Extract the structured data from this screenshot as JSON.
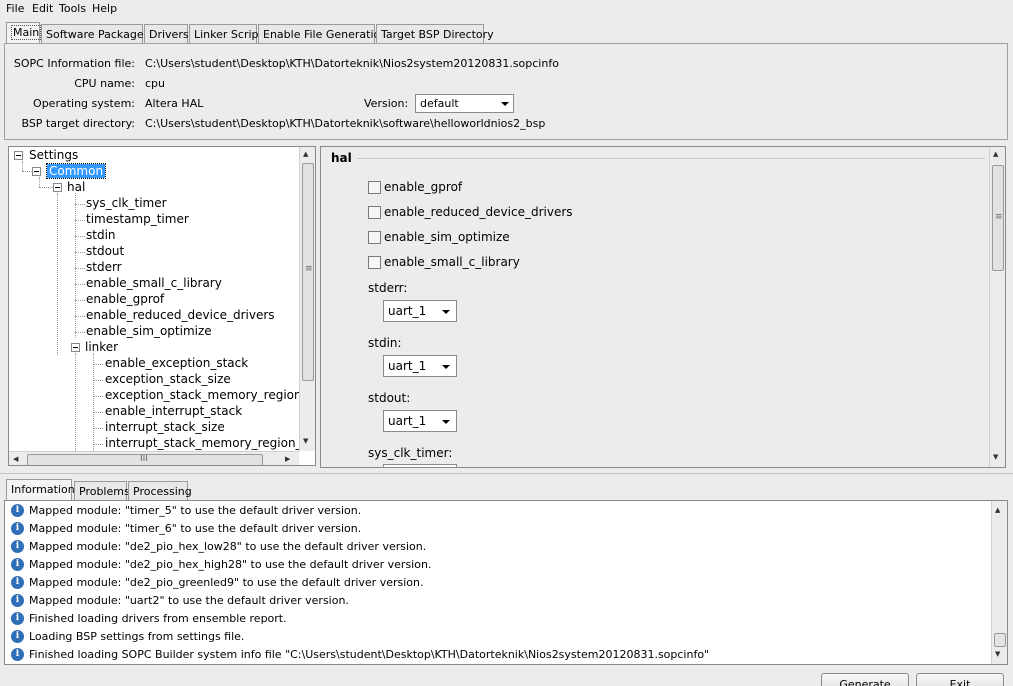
{
  "menu": [
    "File",
    "Edit",
    "Tools",
    "Help"
  ],
  "tabs": [
    "Main",
    "Software Packages",
    "Drivers",
    "Linker Script",
    "Enable File Generation",
    "Target BSP Directory"
  ],
  "main": {
    "sopc_label": "SOPC Information file:",
    "sopc_value": "C:\\Users\\student\\Desktop\\KTH\\Datorteknik\\Nios2system20120831.sopcinfo",
    "cpu_label": "CPU name:",
    "cpu_value": "cpu",
    "os_label": "Operating system:",
    "os_value": "Altera HAL",
    "version_label": "Version:",
    "version_value": "default",
    "bsp_label": "BSP target directory:",
    "bsp_value": "C:\\Users\\student\\Desktop\\KTH\\Datorteknik\\software\\helloworldnios2_bsp"
  },
  "tree": {
    "settings": "Settings",
    "common": "Common",
    "hal": "hal",
    "hal_items": [
      "sys_clk_timer",
      "timestamp_timer",
      "stdin",
      "stdout",
      "stderr",
      "enable_small_c_library",
      "enable_gprof",
      "enable_reduced_device_drivers",
      "enable_sim_optimize"
    ],
    "linker": "linker",
    "linker_items": [
      "enable_exception_stack",
      "exception_stack_size",
      "exception_stack_memory_region_n",
      "enable_interrupt_stack",
      "interrupt_stack_size",
      "interrupt_stack_memory_region_na"
    ],
    "hscroll_grip": "III",
    "vscroll_grip": "≡"
  },
  "hal_panel": {
    "title": "hal",
    "checkboxes": [
      "enable_gprof",
      "enable_reduced_device_drivers",
      "enable_sim_optimize",
      "enable_small_c_library"
    ],
    "stderr_label": "stderr:",
    "stderr_value": "uart_1",
    "stdin_label": "stdin:",
    "stdin_value": "uart_1",
    "stdout_label": "stdout:",
    "stdout_value": "uart_1",
    "sys_clk_label": "sys_clk_timer:",
    "vscroll_grip": "≡"
  },
  "bottom_tabs": [
    "Information",
    "Problems",
    "Processing"
  ],
  "log": [
    "Mapped module: \"timer_5\" to use the default driver version.",
    "Mapped module: \"timer_6\" to use the default driver version.",
    "Mapped module: \"de2_pio_hex_low28\" to use the default driver version.",
    "Mapped module: \"de2_pio_hex_high28\" to use the default driver version.",
    "Mapped module: \"de2_pio_greenled9\" to use the default driver version.",
    "Mapped module: \"uart2\" to use the default driver version.",
    "Finished loading drivers from ensemble report.",
    "Loading BSP settings from settings file.",
    "Finished loading SOPC Builder system info file \"C:\\Users\\student\\Desktop\\KTH\\Datorteknik\\Nios2system20120831.sopcinfo\""
  ],
  "info_icon_glyph": "i",
  "buttons": {
    "generate": "Generate",
    "exit": "Exit"
  }
}
